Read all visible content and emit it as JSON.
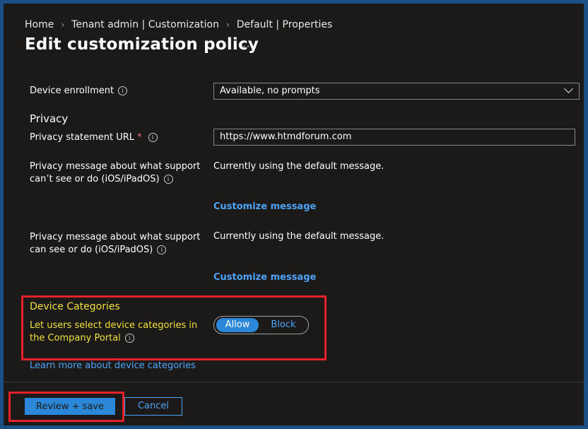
{
  "breadcrumb": [
    "Home",
    "Tenant admin | Customization",
    "Default | Properties"
  ],
  "page_title": "Edit customization policy",
  "more_label": "···",
  "device_enrollment": {
    "label": "Device enrollment",
    "value": "Available, no prompts"
  },
  "privacy": {
    "heading": "Privacy",
    "url_label": "Privacy statement URL",
    "url_required": "*",
    "url_value": "https://www.htmdforum.com",
    "cant_see_label": "Privacy message about what support can’t see or do (iOS/iPadOS)",
    "cant_see_value": "Currently using the default message.",
    "cant_see_link": "Customize message",
    "can_see_label": "Privacy message about what support can see or do (iOS/iPadOS)",
    "can_see_value": "Currently using the default message.",
    "can_see_link": "Customize message"
  },
  "device_categories": {
    "heading": "Device Categories",
    "label": "Let users select device categories in the Company Portal",
    "toggle": {
      "options": [
        "Allow",
        "Block"
      ],
      "selected": "Allow"
    },
    "learn_more": "Learn more about device categories"
  },
  "footer": {
    "primary": "Review + save",
    "secondary": "Cancel"
  },
  "colors": {
    "accent": "#2b88d8",
    "link": "#4fa3f7",
    "highlight": "#e8202a",
    "annotation_text": "#f0e040"
  }
}
